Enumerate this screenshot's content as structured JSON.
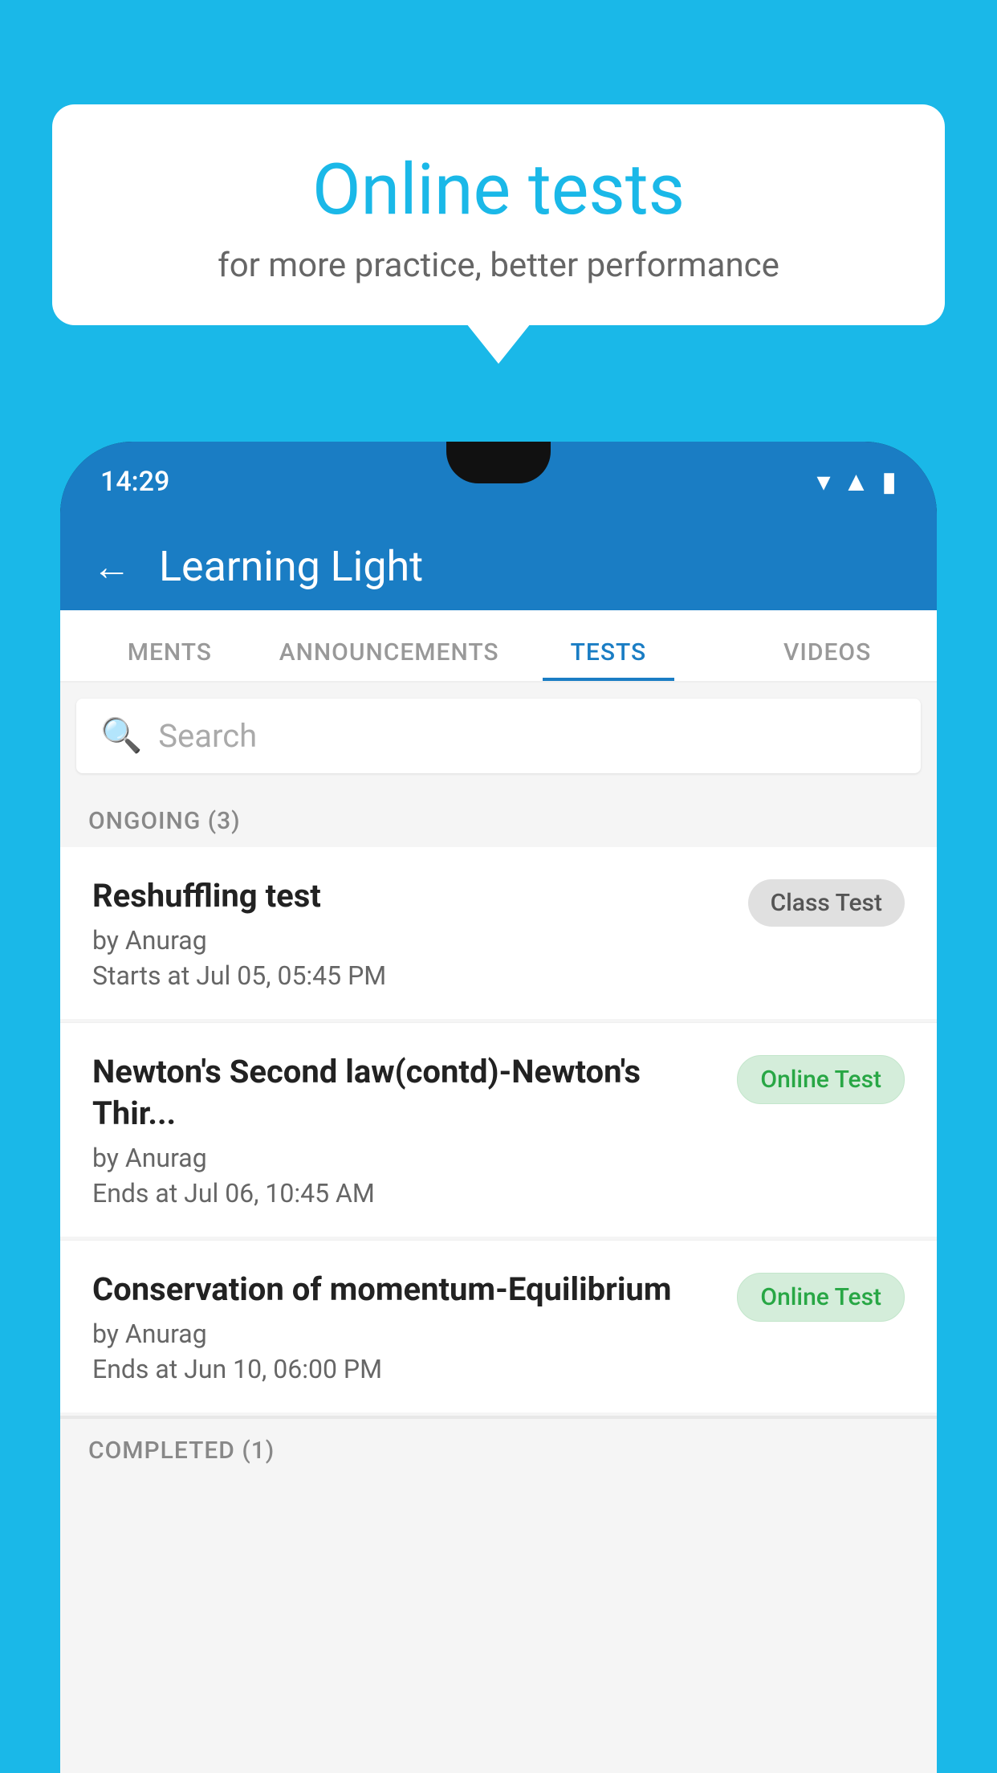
{
  "background": {
    "color": "#1ab8e8"
  },
  "speech_bubble": {
    "title": "Online tests",
    "subtitle": "for more practice, better performance"
  },
  "phone": {
    "status_bar": {
      "time": "14:29",
      "icons": [
        "wifi",
        "signal",
        "battery"
      ]
    },
    "app_header": {
      "title": "Learning Light",
      "back_label": "←"
    },
    "tabs": [
      {
        "label": "MENTS",
        "active": false
      },
      {
        "label": "ANNOUNCEMENTS",
        "active": false
      },
      {
        "label": "TESTS",
        "active": true
      },
      {
        "label": "VIDEOS",
        "active": false
      }
    ],
    "search": {
      "placeholder": "Search"
    },
    "ongoing_section": {
      "label": "ONGOING (3)"
    },
    "tests": [
      {
        "name": "Reshuffling test",
        "author": "by Anurag",
        "date": "Starts at  Jul 05, 05:45 PM",
        "badge": "Class Test",
        "badge_type": "class"
      },
      {
        "name": "Newton's Second law(contd)-Newton's Thir...",
        "author": "by Anurag",
        "date": "Ends at  Jul 06, 10:45 AM",
        "badge": "Online Test",
        "badge_type": "online"
      },
      {
        "name": "Conservation of momentum-Equilibrium",
        "author": "by Anurag",
        "date": "Ends at  Jun 10, 06:00 PM",
        "badge": "Online Test",
        "badge_type": "online"
      }
    ],
    "completed_section": {
      "label": "COMPLETED (1)"
    }
  }
}
